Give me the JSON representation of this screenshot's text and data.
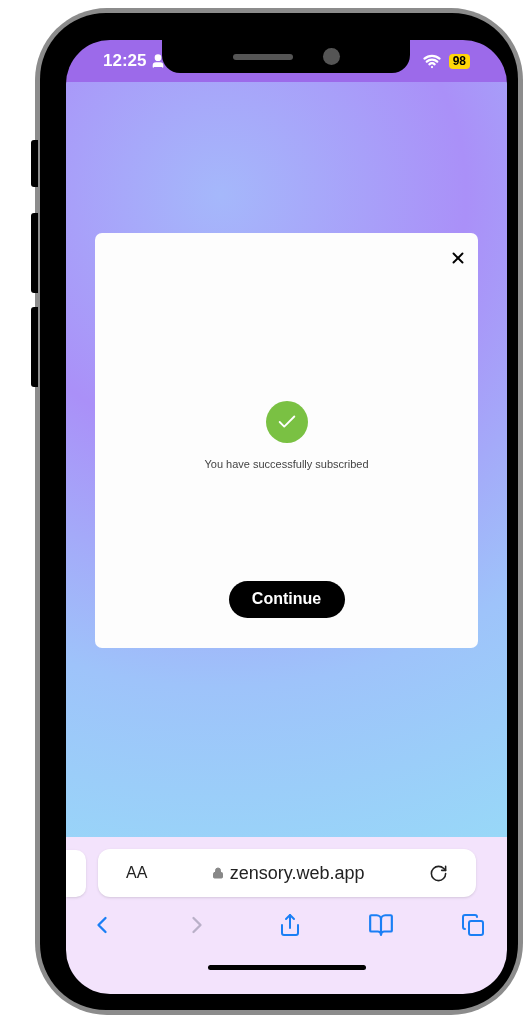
{
  "status_bar": {
    "time": "12:25",
    "battery": "98"
  },
  "dialog": {
    "message": "You have successfully subscribed",
    "button": "Continue"
  },
  "browser_bar": {
    "text_size": "AA",
    "url": "zensory.web.app"
  }
}
